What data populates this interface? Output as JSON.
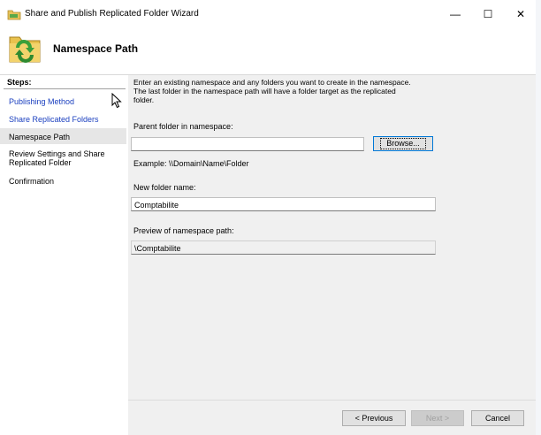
{
  "window": {
    "title": "Share and Publish Replicated Folder Wizard",
    "minimize_glyph": "—",
    "maximize_glyph": "☐",
    "close_glyph": "✕"
  },
  "header": {
    "title": "Namespace Path",
    "icon": "wizard-folder-icon"
  },
  "steps": {
    "title": "Steps:",
    "items": [
      {
        "label": "Publishing Method",
        "state": "link"
      },
      {
        "label": "Share Replicated Folders",
        "state": "link"
      },
      {
        "label": "Namespace Path",
        "state": "active"
      },
      {
        "label": "Review Settings and Share",
        "label2": "Replicated Folder",
        "state": "pending"
      },
      {
        "label": "Confirmation",
        "state": "pending"
      }
    ]
  },
  "content": {
    "description_lines": [
      "Enter an existing namespace and any folders you want to create in the namespace.",
      "The last folder in the namespace path will have a folder target as the replicated",
      "folder."
    ],
    "parent_folder": {
      "label": "Parent folder in namespace:",
      "value": "",
      "browse_label": "Browse...",
      "example": "Example: \\\\Domain\\Name\\Folder"
    },
    "new_folder": {
      "label": "New folder name:",
      "value": "Comptabilite"
    },
    "preview": {
      "label": "Preview of namespace path:",
      "value": "\\Comptabilite"
    }
  },
  "footer": {
    "previous_label": "< Previous",
    "next_label": "Next >",
    "cancel_label": "Cancel"
  },
  "colors": {
    "link": "#1a3fbf",
    "content_bg": "#f0f0f0",
    "focus_border": "#0078d7"
  }
}
